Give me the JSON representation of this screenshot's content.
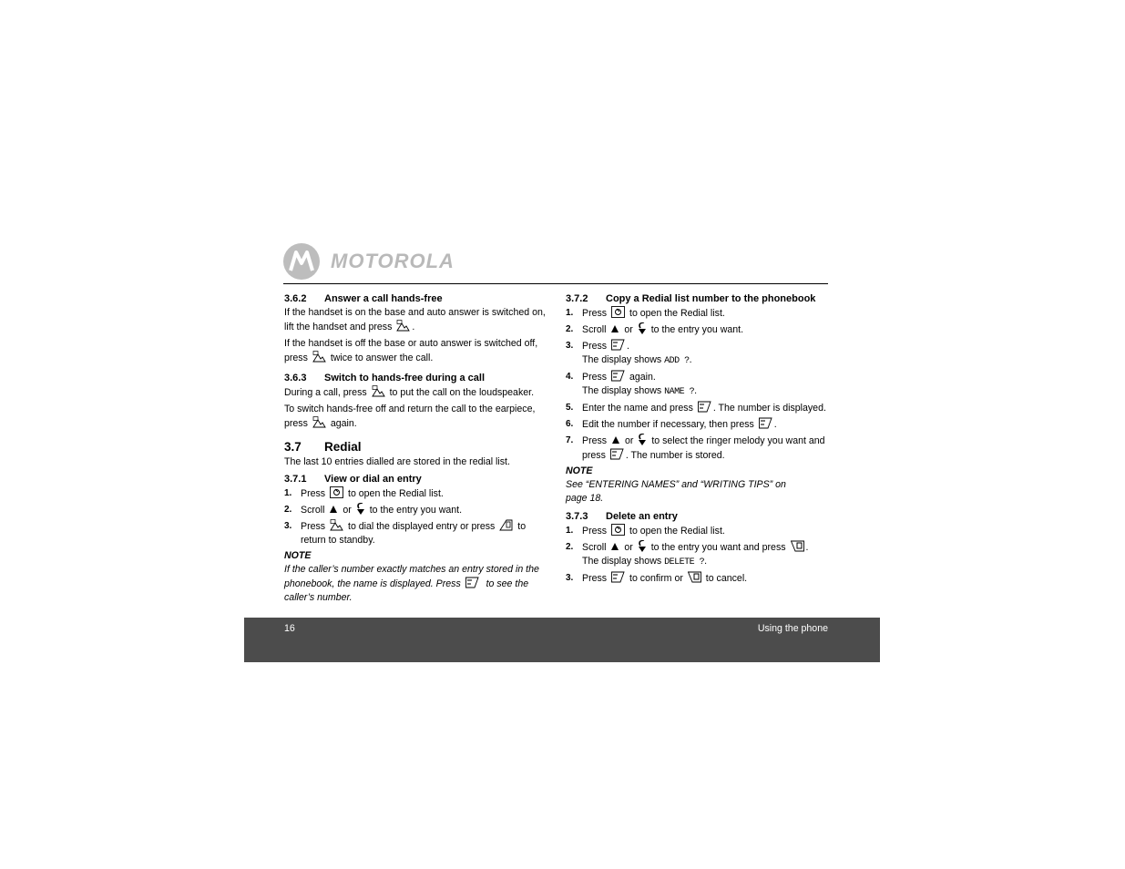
{
  "brand": {
    "name": "MOTOROLA",
    "logo_color": "#bdbdbd"
  },
  "sections": {
    "s362": {
      "number": "3.6.2",
      "title": "Answer a call hands-free",
      "p1a": "If the handset is on the base and auto answer is switched on, lift the handset and press",
      "p1b": ".",
      "p2a": "If the handset is off the base or auto answer is switched off, press",
      "p2b": "twice to answer the call."
    },
    "s363": {
      "number": "3.6.3",
      "title": "Switch to hands-free during a call",
      "p1a": "During a call, press",
      "p1b": "to put the call on the loudspeaker.",
      "p2a": "To switch hands-free off and return the call to the earpiece, press",
      "p2b": "again."
    },
    "s37": {
      "number": "3.7",
      "title": "Redial",
      "intro": "The last 10 entries dialled are stored in the redial list."
    },
    "s371": {
      "number": "3.7.1",
      "title": "View or dial an entry",
      "steps": [
        {
          "n": "1.",
          "a": "Press",
          "b": "to open the Redial list."
        },
        {
          "n": "2.",
          "a": "Scroll",
          "or": "or",
          "b": "to the entry you want."
        },
        {
          "n": "3.",
          "a": "Press",
          "b": "to dial the displayed entry or press",
          "c": "to return to standby."
        }
      ],
      "note_heading": "NOTE",
      "note_a": "If the caller’s number exactly matches an entry stored in the phonebook, the name is displayed. Press",
      "note_b": "to see the caller’s number."
    },
    "s372": {
      "number": "3.7.2",
      "title": "Copy a Redial list number to the phonebook",
      "steps": [
        {
          "n": "1.",
          "a": "Press",
          "b": "to open the Redial list."
        },
        {
          "n": "2.",
          "a": "Scroll",
          "or": "or",
          "b": "to the entry you want."
        },
        {
          "n": "3.",
          "a": "Press",
          "b": ".",
          "c": "The display shows",
          "d": "ADD ?",
          "e": "."
        },
        {
          "n": "4.",
          "a": "Press",
          "b": "again.",
          "c": "The display shows",
          "d": "NAME ?",
          "e": "."
        },
        {
          "n": "5.",
          "a": "Enter the name and press",
          "b": ". The number is displayed."
        },
        {
          "n": "6.",
          "a": "Edit the number if necessary, then press",
          "b": "."
        },
        {
          "n": "7.",
          "a": "Press",
          "or": "or",
          "b": "to select the ringer melody you want and press",
          "c": ". The number is stored."
        }
      ],
      "note_heading": "NOTE",
      "note": "See “ENTERING NAMES” and “WRITING TIPS” on page 18."
    },
    "s373": {
      "number": "3.7.3",
      "title": "Delete an entry",
      "steps": [
        {
          "n": "1.",
          "a": "Press",
          "b": "to open the Redial list."
        },
        {
          "n": "2.",
          "a": "Scroll",
          "or": "or",
          "b": "to the entry you want and press",
          "c": ".",
          "d": "The display shows",
          "e": "DELETE ?",
          "f": "."
        },
        {
          "n": "3.",
          "a": "Press",
          "b": "to confirm or",
          "c": "to cancel."
        }
      ]
    }
  },
  "footer": {
    "page_number": "16",
    "section": "Using the phone",
    "bg_color": "#4c4c4c"
  }
}
